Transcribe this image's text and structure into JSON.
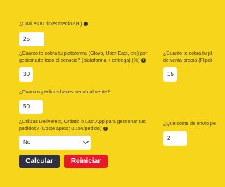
{
  "form": {
    "ticket": {
      "label": "¿Cual es tu ticket medio? (€)",
      "value": "25"
    },
    "platform_fee": {
      "label_line1": "¿Cuanto te cobra tu plataforma (Glovo, Uber Eats, etc) por",
      "label_line2": "gestionarte todo el servicio? (plataforma + entrega) (%)",
      "value": "30"
    },
    "own_sales_fee": {
      "label_line1": "¿Cuanto te cobra tu pl",
      "label_line2": "de venta propia (Flipdi",
      "value": "15"
    },
    "weekly_orders": {
      "label": "¿Cuantos pedidos haces semanalmente?",
      "value": "50"
    },
    "manager_tools": {
      "label_line1": "¿Utilizas Deliverect, Ordatic o Last.App para gestionar tus",
      "label_line2": "pedidos? (Coste aprox: 0.15€/pedido)",
      "selected": "No"
    },
    "shipping_cost": {
      "label": "¿Que coste de envío pe",
      "value": "2"
    }
  },
  "buttons": {
    "calculate": "Calcular",
    "reset": "Reiniciar"
  },
  "colors": {
    "background": "#f7d51a",
    "calculate_button": "#2f3140",
    "reset_button": "#e8192c"
  },
  "icons": {
    "info": "info-circle-icon",
    "dropdown": "chevron-down-icon"
  }
}
